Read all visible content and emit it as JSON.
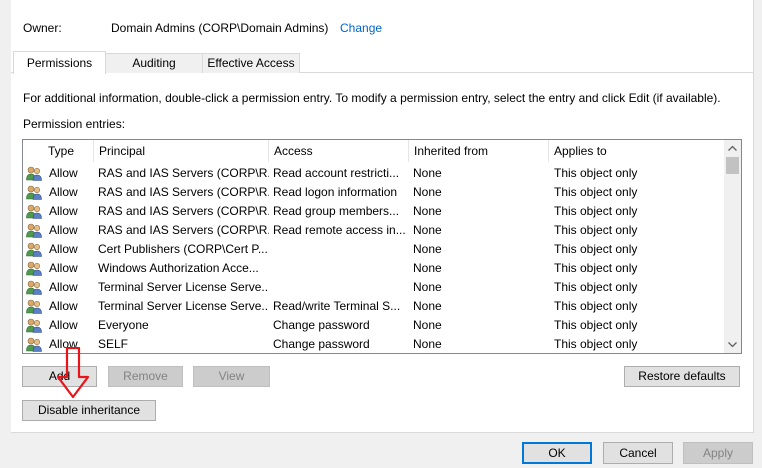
{
  "owner": {
    "label": "Owner:",
    "value": "Domain Admins (CORP\\Domain Admins)",
    "change_link": "Change"
  },
  "tabs": [
    {
      "label": "Permissions",
      "active": true
    },
    {
      "label": "Auditing",
      "active": false
    },
    {
      "label": "Effective Access",
      "active": false
    }
  ],
  "info_text": "For additional information, double-click a permission entry. To modify a permission entry, select the entry and click Edit (if available).",
  "entries_label": "Permission entries:",
  "columns": [
    "Type",
    "Principal",
    "Access",
    "Inherited from",
    "Applies to"
  ],
  "rows": [
    {
      "type": "Allow",
      "principal": "RAS and IAS Servers (CORP\\R...",
      "access": "Read account restricti...",
      "inherited": "None",
      "applies": "This object only"
    },
    {
      "type": "Allow",
      "principal": "RAS and IAS Servers (CORP\\R...",
      "access": "Read logon information",
      "inherited": "None",
      "applies": "This object only"
    },
    {
      "type": "Allow",
      "principal": "RAS and IAS Servers (CORP\\R...",
      "access": "Read group members...",
      "inherited": "None",
      "applies": "This object only"
    },
    {
      "type": "Allow",
      "principal": "RAS and IAS Servers (CORP\\R...",
      "access": "Read remote access in...",
      "inherited": "None",
      "applies": "This object only"
    },
    {
      "type": "Allow",
      "principal": "Cert Publishers (CORP\\Cert P...",
      "access": "",
      "inherited": "None",
      "applies": "This object only"
    },
    {
      "type": "Allow",
      "principal": "Windows Authorization Acce...",
      "access": "",
      "inherited": "None",
      "applies": "This object only"
    },
    {
      "type": "Allow",
      "principal": "Terminal Server License Serve...",
      "access": "",
      "inherited": "None",
      "applies": "This object only"
    },
    {
      "type": "Allow",
      "principal": "Terminal Server License Serve...",
      "access": "Read/write Terminal S...",
      "inherited": "None",
      "applies": "This object only"
    },
    {
      "type": "Allow",
      "principal": "Everyone",
      "access": "Change password",
      "inherited": "None",
      "applies": "This object only"
    },
    {
      "type": "Allow",
      "principal": "SELF",
      "access": "Change password",
      "inherited": "None",
      "applies": "This object only"
    }
  ],
  "buttons": {
    "add": "Add",
    "remove": "Remove",
    "view": "View",
    "restore_defaults": "Restore defaults",
    "disable_inheritance": "Disable inheritance",
    "ok": "OK",
    "cancel": "Cancel",
    "apply": "Apply"
  },
  "icons": {
    "row_icon": "user-group-icon",
    "annotation": "red-down-arrow"
  },
  "colors": {
    "link": "#0066cc",
    "annotation_arrow": "#e8141a",
    "focus_border": "#0078d7"
  }
}
